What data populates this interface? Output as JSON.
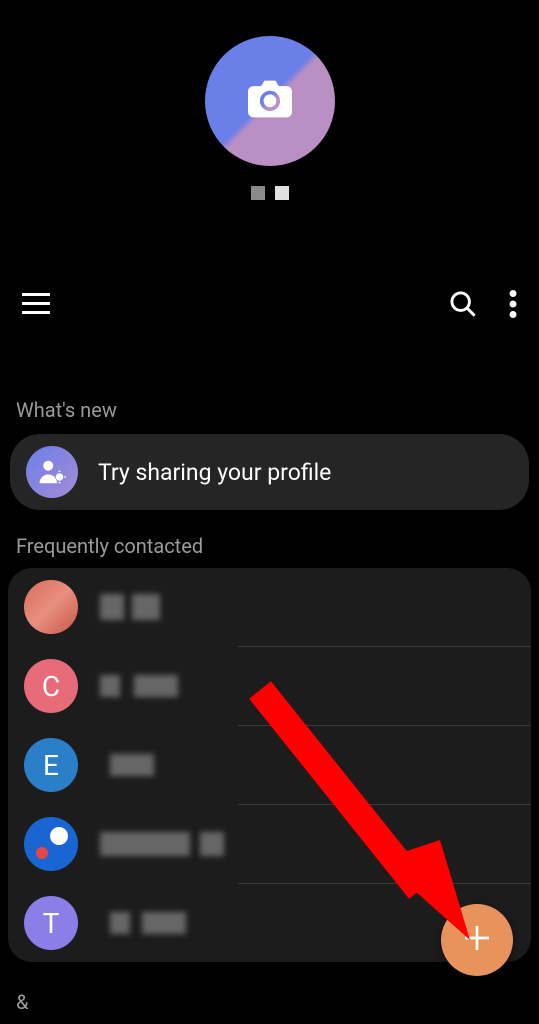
{
  "sections": {
    "whats_new_label": "What's new",
    "frequently_contacted_label": "Frequently contacted"
  },
  "whats_new": {
    "message": "Try sharing your profile"
  },
  "contacts": [
    {
      "avatar_letter": "",
      "avatar_style": "avatar-img"
    },
    {
      "avatar_letter": "C",
      "avatar_style": "avatar-c"
    },
    {
      "avatar_letter": "E",
      "avatar_style": "avatar-e"
    },
    {
      "avatar_letter": "",
      "avatar_style": "avatar-pp"
    },
    {
      "avatar_letter": "T",
      "avatar_style": "avatar-t"
    }
  ],
  "footer": {
    "section_letter": "&"
  }
}
